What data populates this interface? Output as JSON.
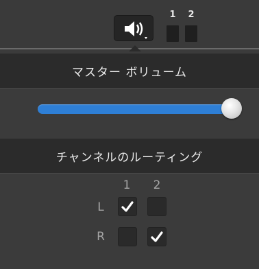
{
  "toolbar": {
    "speaker_icon": "speaker-volume-icon",
    "meters": [
      {
        "label": "1",
        "level": 0
      },
      {
        "label": "2",
        "level": 0
      }
    ]
  },
  "master_volume": {
    "title": "マスター ボリューム",
    "value": 1.0,
    "accent_color": "#2e7fd6"
  },
  "routing": {
    "title": "チャンネルのルーティング",
    "columns": [
      "1",
      "2"
    ],
    "rows": [
      {
        "label": "L",
        "checked": [
          true,
          false
        ]
      },
      {
        "label": "R",
        "checked": [
          false,
          true
        ]
      }
    ]
  }
}
